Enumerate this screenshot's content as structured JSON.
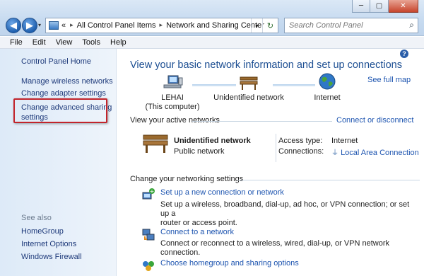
{
  "window": {
    "controls": {
      "minimize": "─",
      "maximize": "▢",
      "close": "✕"
    }
  },
  "nav": {
    "back_glyph": "◀",
    "forward_glyph": "▶",
    "history_glyph": "▾"
  },
  "address": {
    "overflow": "«",
    "crumbs": [
      "All Control Panel Items",
      "Network and Sharing Center"
    ],
    "separator": "▸",
    "drop_glyph": "▾",
    "refresh_glyph": "↻"
  },
  "search": {
    "placeholder": "Search Control Panel",
    "icon": "search-icon"
  },
  "menu": [
    "File",
    "Edit",
    "View",
    "Tools",
    "Help"
  ],
  "sidebar": {
    "home": "Control Panel Home",
    "links": [
      "Manage wireless networks",
      "Change adapter settings"
    ],
    "advanced_line1": "Change advanced sharing",
    "advanced_line2": "settings",
    "see_also_title": "See also",
    "see_also": [
      "HomeGroup",
      "Internet Options",
      "Windows Firewall"
    ]
  },
  "main": {
    "help_glyph": "?",
    "heading": "View your basic network information and set up connections",
    "see_full_map": "See full map",
    "map": {
      "computer_name": "LEHAI",
      "computer_sub": "(This computer)",
      "network": "Unidentified network",
      "internet": "Internet"
    },
    "active": {
      "title": "View your active networks",
      "connect_link": "Connect or disconnect",
      "network_name": "Unidentified network",
      "network_type": "Public network",
      "access_type_label": "Access type:",
      "access_type_value": "Internet",
      "connections_label": "Connections:",
      "connections_value": "Local Area Connection"
    },
    "change": {
      "title": "Change your networking settings",
      "tasks": [
        {
          "link": "Set up a new connection or network",
          "desc_line1": "Set up a wireless, broadband, dial-up, ad hoc, or VPN connection; or set up a",
          "desc_line2": "router or access point."
        },
        {
          "link": "Connect to a network",
          "desc_line1": "Connect or reconnect to a wireless, wired, dial-up, or VPN network connection."
        },
        {
          "link": "Choose homegroup and sharing options"
        }
      ]
    }
  },
  "colors": {
    "link": "#1e55b0",
    "heading": "#1c4e92",
    "highlight": "#c2242c"
  }
}
